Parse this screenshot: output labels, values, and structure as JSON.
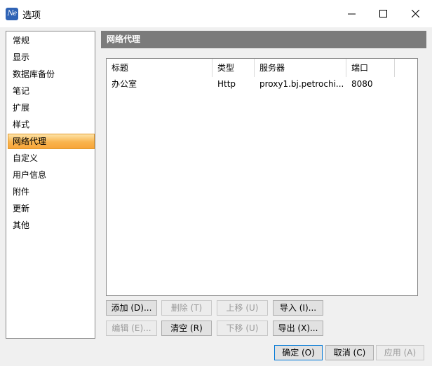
{
  "window": {
    "title": "选项",
    "app_icon_text": "Ne"
  },
  "nav": {
    "items": [
      {
        "label": "常规"
      },
      {
        "label": "显示"
      },
      {
        "label": "数据库备份"
      },
      {
        "label": "笔记"
      },
      {
        "label": "扩展"
      },
      {
        "label": "样式"
      },
      {
        "label": "网络代理",
        "selected": true
      },
      {
        "label": "自定义"
      },
      {
        "label": "用户信息"
      },
      {
        "label": "附件"
      },
      {
        "label": "更新"
      },
      {
        "label": "其他"
      }
    ]
  },
  "section": {
    "title": "网络代理"
  },
  "proxy_table": {
    "columns": [
      "标题",
      "类型",
      "服务器",
      "端口"
    ],
    "rows": [
      [
        "办公室",
        "Http",
        "proxy1.bj.petrochi...",
        "8080"
      ]
    ]
  },
  "proxy_buttons": {
    "add": "添加 (D)...",
    "delete": "删除 (T)",
    "move_up": "上移 (U)",
    "import": "导入 (I)...",
    "edit": "编辑 (E)...",
    "clear": "清空 (R)",
    "move_down": "下移 (U)",
    "export": "导出 (X)..."
  },
  "dialog_buttons": {
    "ok": "确定 (O)",
    "cancel": "取消 (C)",
    "apply": "应用 (A)"
  },
  "colors": {
    "selected_nav": "#f9b44e",
    "section_header": "#7b7b7b",
    "default_button_border": "#0078d7"
  }
}
